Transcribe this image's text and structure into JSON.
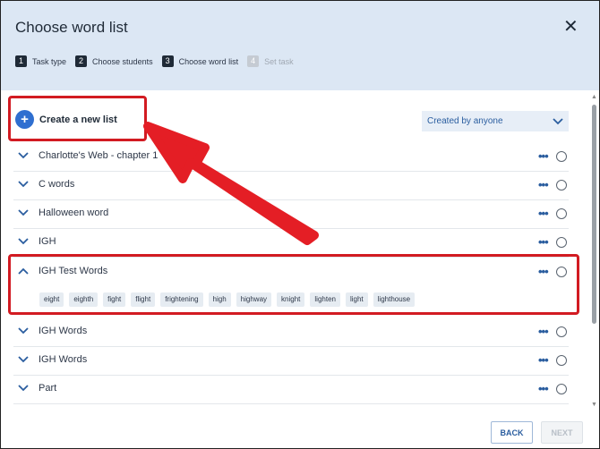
{
  "dialog": {
    "title": "Choose word list",
    "close_label": "✕"
  },
  "steps": [
    {
      "num": "1",
      "label": "Task type"
    },
    {
      "num": "2",
      "label": "Choose students"
    },
    {
      "num": "3",
      "label": "Choose word list"
    },
    {
      "num": "4",
      "label": "Set task"
    }
  ],
  "create": {
    "plus": "+",
    "label": "Create a new list"
  },
  "filter": {
    "selected": "Created by anyone"
  },
  "list": {
    "dots": "•••",
    "items": [
      {
        "label": "Charlotte's Web - chapter 1"
      },
      {
        "label": "C words"
      },
      {
        "label": "Halloween word"
      },
      {
        "label": "IGH"
      },
      {
        "label": "IGH Test Words"
      },
      {
        "label": "IGH Words"
      },
      {
        "label": "IGH Words"
      },
      {
        "label": "Part"
      }
    ],
    "expanded_words": [
      "eight",
      "eighth",
      "fight",
      "flight",
      "frightening",
      "high",
      "highway",
      "knight",
      "lighten",
      "light",
      "lighthouse"
    ]
  },
  "footer": {
    "back": "BACK",
    "next": "NEXT"
  },
  "colors": {
    "accent": "#2f6fd0",
    "highlight": "#d21b22",
    "header_bg": "#dce7f4"
  }
}
